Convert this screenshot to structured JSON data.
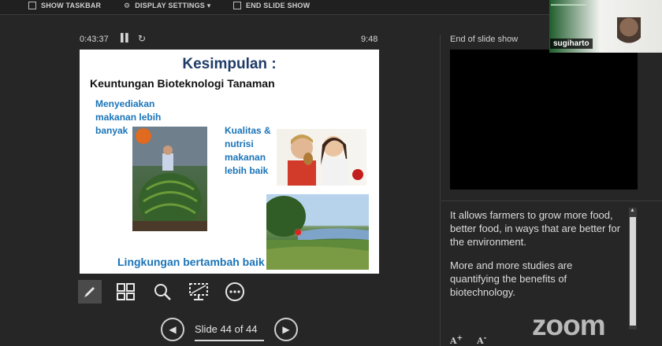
{
  "toolbar": {
    "show_taskbar": "SHOW TASKBAR",
    "display_settings": "DISPLAY SETTINGS ▾",
    "end_slide_show": "END SLIDE SHOW"
  },
  "presenter": {
    "elapsed_time": "0:43:37",
    "clock": "9:48"
  },
  "slide": {
    "title": "Kesimpulan :",
    "subtitle": "Keuntungan Bioteknologi Tanaman",
    "point1": "Menyediakan makanan lebih banyak",
    "point2": "Kualitas & nutrisi makanan lebih baik",
    "point3": "Lingkungan bertambah baik"
  },
  "navigation": {
    "slide_counter": "Slide 44 of 44",
    "progress": 1.0
  },
  "next_slide": {
    "label": "End of slide show"
  },
  "notes": {
    "paragraph1": "It allows farmers to grow more food, better food, in ways that are better for the environment.",
    "paragraph2": "More and more studies are quantifying the benefits of biotechnology."
  },
  "video": {
    "participant_name": "sugiharto"
  },
  "branding": {
    "logo_text": "zoom"
  },
  "icons": [
    "pen-icon",
    "slides-grid-icon",
    "magnifier-icon",
    "screen-icon",
    "more-icon",
    "pause-icon",
    "reset-icon",
    "prev-icon",
    "next-icon"
  ]
}
